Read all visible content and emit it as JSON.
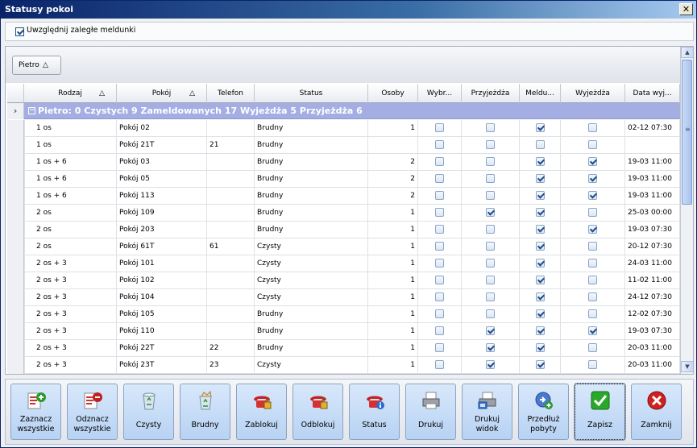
{
  "window": {
    "title": "Statusy pokoi",
    "close_label": "✕"
  },
  "top": {
    "include_overdue_label": "Uwzględnij zaległe meldunki",
    "include_overdue_checked": true
  },
  "group_panel": {
    "button_label": "Pietro",
    "sort_glyph": "△"
  },
  "columns": [
    {
      "label": "Rodzaj",
      "sort": "△"
    },
    {
      "label": "Pokój",
      "sort": "△"
    },
    {
      "label": "Telefon",
      "sort": ""
    },
    {
      "label": "Status",
      "sort": ""
    },
    {
      "label": "Osoby",
      "sort": ""
    },
    {
      "label": "Wybr...",
      "sort": ""
    },
    {
      "label": "Przyjeżdża",
      "sort": ""
    },
    {
      "label": "Meldu...",
      "sort": ""
    },
    {
      "label": "Wyjeżdża",
      "sort": ""
    },
    {
      "label": "Data wyj...",
      "sort": ""
    }
  ],
  "group_row": {
    "expander": "›",
    "collapse": "−",
    "text": "Pietro: 0  Czystych 9 Zameldowanych 17 Wyjeżdża 5 Przyjeżdża 6"
  },
  "rows": [
    {
      "rodzaj": "1 os",
      "pokoj": "Pokój 02",
      "telefon": "",
      "status": "Brudny",
      "osoby": "1",
      "wybr": false,
      "przyj": false,
      "meld": true,
      "wyj": false,
      "data": "02-12 07:30"
    },
    {
      "rodzaj": "1 os",
      "pokoj": "Pokój 21T",
      "telefon": "21",
      "status": "Brudny",
      "osoby": "",
      "wybr": false,
      "przyj": false,
      "meld": false,
      "wyj": false,
      "data": ""
    },
    {
      "rodzaj": "1 os + 6",
      "pokoj": "Pokój 03",
      "telefon": "",
      "status": "Brudny",
      "osoby": "2",
      "wybr": false,
      "przyj": false,
      "meld": true,
      "wyj": true,
      "data": "19-03 11:00"
    },
    {
      "rodzaj": "1 os + 6",
      "pokoj": "Pokój 05",
      "telefon": "",
      "status": "Brudny",
      "osoby": "2",
      "wybr": false,
      "przyj": false,
      "meld": true,
      "wyj": true,
      "data": "19-03 11:00"
    },
    {
      "rodzaj": "1 os + 6",
      "pokoj": "Pokój 113",
      "telefon": "",
      "status": "Brudny",
      "osoby": "2",
      "wybr": false,
      "przyj": false,
      "meld": true,
      "wyj": true,
      "data": "19-03 11:00"
    },
    {
      "rodzaj": "2 os",
      "pokoj": "Pokój 109",
      "telefon": "",
      "status": "Brudny",
      "osoby": "1",
      "wybr": false,
      "przyj": true,
      "meld": true,
      "wyj": false,
      "data": "25-03 00:00"
    },
    {
      "rodzaj": "2 os",
      "pokoj": "Pokój 203",
      "telefon": "",
      "status": "Brudny",
      "osoby": "1",
      "wybr": false,
      "przyj": false,
      "meld": true,
      "wyj": true,
      "data": "19-03 07:30"
    },
    {
      "rodzaj": "2 os",
      "pokoj": "Pokój 61T",
      "telefon": "61",
      "status": "Czysty",
      "osoby": "1",
      "wybr": false,
      "przyj": false,
      "meld": true,
      "wyj": false,
      "data": "20-12 07:30"
    },
    {
      "rodzaj": "2 os + 3",
      "pokoj": "Pokój 101",
      "telefon": "",
      "status": "Czysty",
      "osoby": "1",
      "wybr": false,
      "przyj": false,
      "meld": true,
      "wyj": false,
      "data": "24-03 11:00"
    },
    {
      "rodzaj": "2 os + 3",
      "pokoj": "Pokój 102",
      "telefon": "",
      "status": "Czysty",
      "osoby": "1",
      "wybr": false,
      "przyj": false,
      "meld": true,
      "wyj": false,
      "data": "11-02 11:00"
    },
    {
      "rodzaj": "2 os + 3",
      "pokoj": "Pokój 104",
      "telefon": "",
      "status": "Czysty",
      "osoby": "1",
      "wybr": false,
      "przyj": false,
      "meld": true,
      "wyj": false,
      "data": "24-12 07:30"
    },
    {
      "rodzaj": "2 os + 3",
      "pokoj": "Pokój 105",
      "telefon": "",
      "status": "Brudny",
      "osoby": "1",
      "wybr": false,
      "przyj": false,
      "meld": true,
      "wyj": false,
      "data": "12-02 07:30"
    },
    {
      "rodzaj": "2 os + 3",
      "pokoj": "Pokój 110",
      "telefon": "",
      "status": "Brudny",
      "osoby": "1",
      "wybr": false,
      "przyj": true,
      "meld": true,
      "wyj": true,
      "data": "19-03 07:30"
    },
    {
      "rodzaj": "2 os + 3",
      "pokoj": "Pokój 22T",
      "telefon": "22",
      "status": "Brudny",
      "osoby": "1",
      "wybr": false,
      "przyj": true,
      "meld": true,
      "wyj": false,
      "data": "20-03 11:00"
    },
    {
      "rodzaj": "2 os + 3",
      "pokoj": "Pokój 23T",
      "telefon": "23",
      "status": "Czysty",
      "osoby": "1",
      "wybr": false,
      "przyj": true,
      "meld": true,
      "wyj": false,
      "data": "20-03 11:00"
    }
  ],
  "toolbar": [
    {
      "label": "Zaznacz wszystkie",
      "icon": "select-all-icon"
    },
    {
      "label": "Odznacz wszystkie",
      "icon": "deselect-all-icon"
    },
    {
      "label": "Czysty",
      "icon": "recycle-bin-empty-icon"
    },
    {
      "label": "Brudny",
      "icon": "recycle-bin-full-icon"
    },
    {
      "label": "Zablokuj",
      "icon": "phone-lock-icon"
    },
    {
      "label": "Odblokuj",
      "icon": "phone-unlock-icon"
    },
    {
      "label": "Status",
      "icon": "phone-info-icon"
    },
    {
      "label": "Drukuj",
      "icon": "printer-icon"
    },
    {
      "label": "Drukuj widok",
      "icon": "print-view-icon"
    },
    {
      "label": "Przedłuż pobyty",
      "icon": "extend-stay-icon"
    },
    {
      "label": "Zapisz",
      "icon": "green-check-icon"
    },
    {
      "label": "Zamknij",
      "icon": "red-close-icon"
    }
  ],
  "colors": {
    "group_row": "#a4aee3",
    "title_bar": "#0a246a",
    "button_face": "#c8ddf6"
  }
}
